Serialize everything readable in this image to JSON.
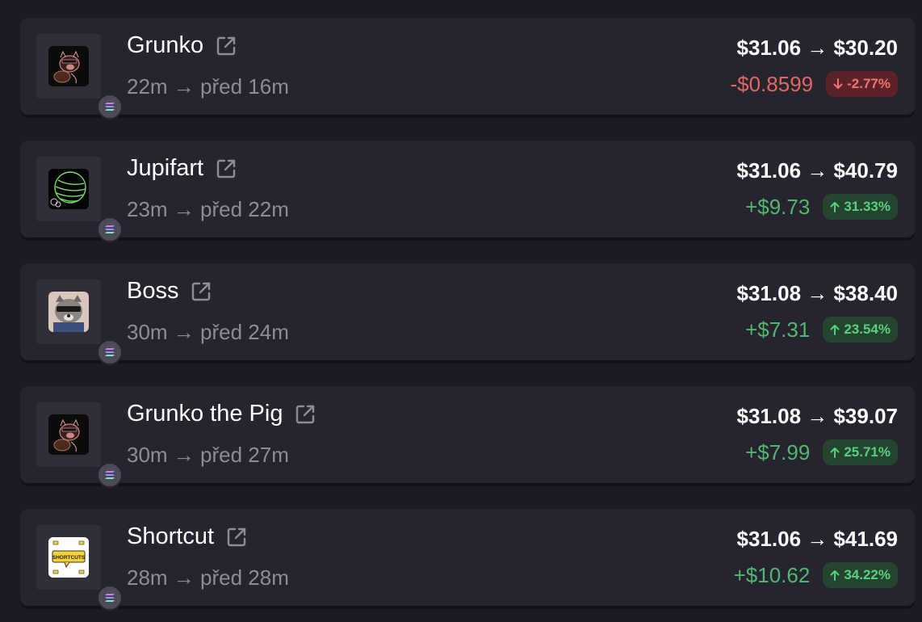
{
  "colors": {
    "background": "#1b1a22",
    "card": "#26252f",
    "positive": "#4fb86e",
    "negative": "#e0695f"
  },
  "trades": [
    {
      "name": "Grunko",
      "time": "22m → před 16m",
      "price": "$31.06 → $30.20",
      "change": "-$0.8599",
      "pct": "-2.77%",
      "direction": "down",
      "icon": "pig-token-icon"
    },
    {
      "name": "Jupifart",
      "time": "23m → před 22m",
      "price": "$31.06 → $40.79",
      "change": "+$9.73",
      "pct": "31.33%",
      "direction": "up",
      "icon": "jupiter-token-icon"
    },
    {
      "name": "Boss",
      "time": "30m → před 24m",
      "price": "$31.08 → $38.40",
      "change": "+$7.31",
      "pct": "23.54%",
      "direction": "up",
      "icon": "raccoon-token-icon"
    },
    {
      "name": "Grunko the Pig",
      "time": "30m → před 27m",
      "price": "$31.08 → $39.07",
      "change": "+$7.99",
      "pct": "25.71%",
      "direction": "up",
      "icon": "pig-token-icon"
    },
    {
      "name": "Shortcut",
      "time": "28m → před 28m",
      "price": "$31.06 → $41.69",
      "change": "+$10.62",
      "pct": "34.22%",
      "direction": "up",
      "icon": "shortcuts-token-icon"
    }
  ],
  "token_art": {
    "shortcut_text": "SHORTCUTS"
  }
}
